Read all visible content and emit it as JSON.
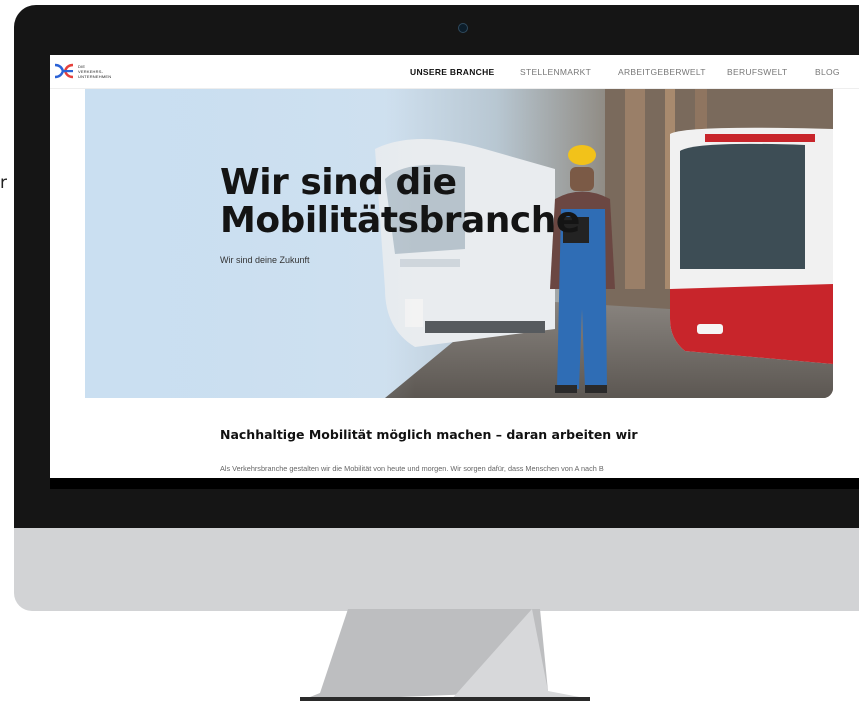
{
  "fragment": {
    "text": "r"
  },
  "nav": {
    "logo_text": "DIE\nVERKEHRS-\nUNTERNEHMEN",
    "items": [
      {
        "label": "UNSERE BRANCHE",
        "active": true
      },
      {
        "label": "STELLENMARKT",
        "active": false
      },
      {
        "label": "ARBEITGEBERWELT",
        "active": false
      },
      {
        "label": "BERUFSWELT",
        "active": false
      },
      {
        "label": "BLOG",
        "active": false
      }
    ]
  },
  "hero": {
    "title_line1": "Wir sind die",
    "title_line2": "Mobilitätsbranche",
    "subtitle": "Wir sind deine Zukunft"
  },
  "section": {
    "title": "Nachhaltige Mobilität möglich machen – daran arbeiten wir",
    "text": "Als Verkehrsbranche gestalten wir die Mobilität von heute und morgen. Wir sorgen dafür, dass Menschen von A nach B"
  },
  "colors": {
    "logo_blue": "#2b62d6",
    "logo_red": "#e6413c",
    "bus_red": "#c8252b",
    "overall_blue": "#2f6db5",
    "helmet_yellow": "#f2c21a"
  }
}
